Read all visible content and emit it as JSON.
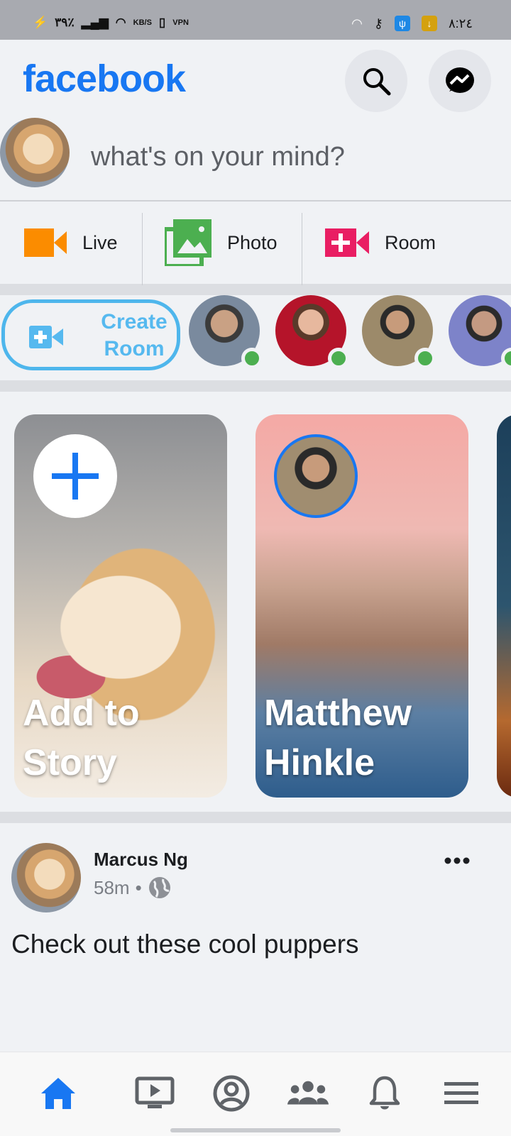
{
  "status_bar": {
    "left_text": "٣٩٪",
    "data_rate": "KB/S",
    "vpn": "VPN",
    "time": "٨:٢٤"
  },
  "app_bar": {
    "brand": "facebook",
    "search_icon": "search-icon",
    "messenger_icon": "messenger-icon"
  },
  "composer": {
    "prompt": "what's on your mind?"
  },
  "actions": [
    {
      "label": "Live",
      "icon": "video-camera-icon",
      "color": "#fb8c00"
    },
    {
      "label": "Photo",
      "icon": "photos-icon",
      "color": "#4caf50"
    },
    {
      "label": "Room",
      "icon": "room-plus-camera-icon",
      "color": "#e91e63"
    }
  ],
  "rooms": {
    "create_room_line1": "Create",
    "create_room_line2": "Room",
    "online_users_count": 4
  },
  "stories": {
    "add_story_line1": "Add to",
    "add_story_line2": "Story",
    "story_user_first": "Matthew",
    "story_user_last": "Hinkle"
  },
  "post": {
    "author": "Marcus Ng",
    "time": "58m",
    "text": "Check out these cool puppers"
  },
  "bottom_tabs": [
    {
      "name": "home-icon",
      "active": true
    },
    {
      "name": "watch-icon",
      "active": false
    },
    {
      "name": "profile-icon",
      "active": false
    },
    {
      "name": "groups-icon",
      "active": false
    },
    {
      "name": "notifications-icon",
      "active": false
    },
    {
      "name": "menu-icon",
      "active": false
    }
  ],
  "colors": {
    "brand": "#1877f2",
    "online": "#4caf50",
    "create_room": "#4eb6ec"
  }
}
